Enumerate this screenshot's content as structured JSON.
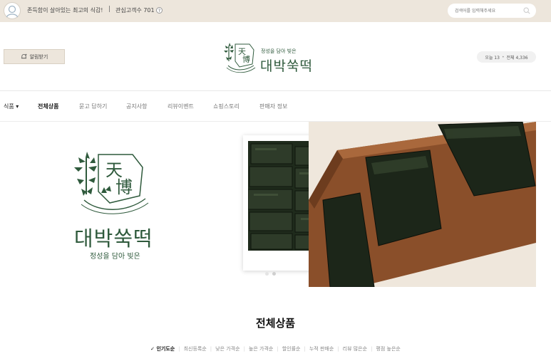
{
  "topbar": {
    "tagline": "존득함이 살아있는 최고의 식감!",
    "separator": "|",
    "followers_label": "관심고객수 701",
    "help_icon": "?",
    "search_placeholder": "검색어를 입력해주세요",
    "bg_color": "#ede6dc"
  },
  "header": {
    "notify_label": "알림받기",
    "logo_sub": "정성을 담아 빚은",
    "logo_main": "대박쑥떡",
    "visits_today": "오늘 13",
    "visits_dot": "•",
    "visits_total": "전체 4,336"
  },
  "nav": {
    "items": [
      {
        "label": "식품 ▾"
      },
      {
        "label": "전체상품"
      },
      {
        "label": "묻고 답하기"
      },
      {
        "label": "공지사항"
      },
      {
        "label": "리뷰이벤트"
      },
      {
        "label": "쇼핑스토리"
      },
      {
        "label": "판매자 정보"
      }
    ]
  },
  "banner": {
    "title": "대박쑥떡",
    "subtitle": "정성을 담아 빚은",
    "brand_color": "#2f5a3c"
  },
  "section": {
    "title": "전체상품",
    "sort_options": [
      {
        "label": "인기도순"
      },
      {
        "label": "최신등록순"
      },
      {
        "label": "낮은 가격순"
      },
      {
        "label": "높은 가격순"
      },
      {
        "label": "할인률순"
      },
      {
        "label": "누적 판매순"
      },
      {
        "label": "리뷰 많은순"
      },
      {
        "label": "평점 높은순"
      }
    ],
    "check_icon": "✓"
  }
}
